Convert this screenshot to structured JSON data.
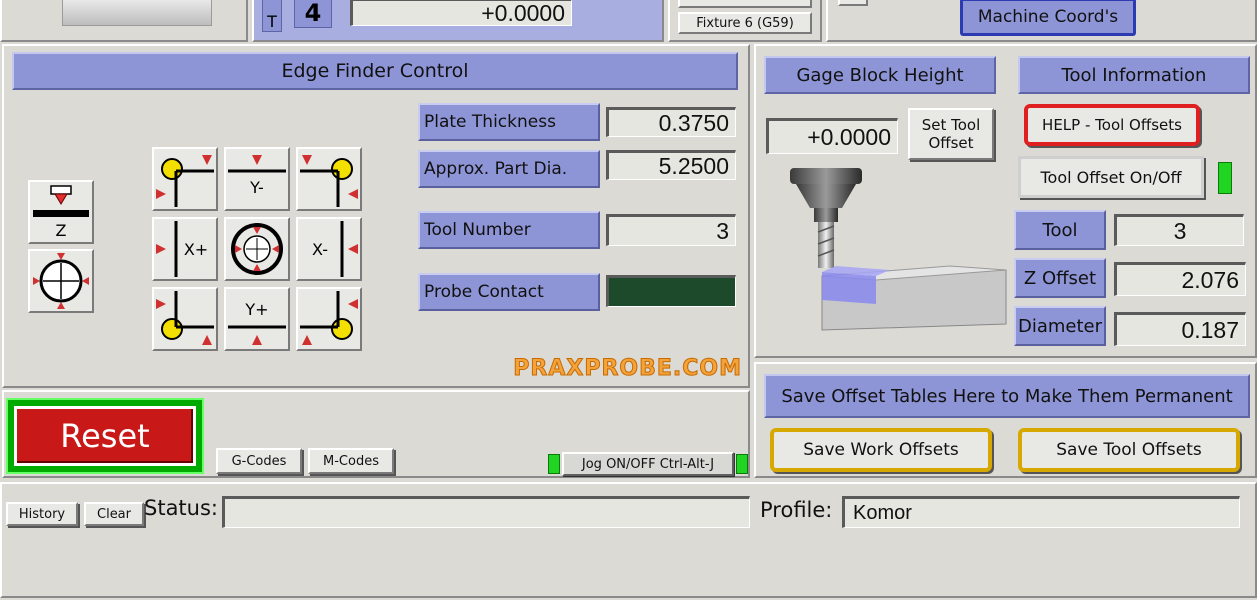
{
  "top": {
    "tool_letter": "T",
    "tool_number": "4",
    "tool_dro": "+0.0000",
    "fixture_label": "Fixture 6 (G59)",
    "machine_coords_label": "Machine Coord's"
  },
  "edge_finder": {
    "title": "Edge Finder Control",
    "plate_thickness_label": "Plate Thickness",
    "plate_thickness_value": "0.3750",
    "part_dia_label": "Approx. Part Dia.",
    "part_dia_value": "5.2500",
    "tool_number_label": "Tool Number",
    "tool_number_value": "3",
    "probe_contact_label": "Probe Contact",
    "z_label": "Z",
    "grid_labels": {
      "y_minus": "Y-",
      "x_plus": "X+",
      "x_minus": "X-",
      "y_plus": "Y+"
    },
    "logo_text": "PRAXPROBE.COM"
  },
  "gage_block": {
    "title": "Gage Block Height",
    "value": "+0.0000",
    "set_tool_offset_label": "Set Tool Offset"
  },
  "tool_info": {
    "title": "Tool Information",
    "help_label": "HELP - Tool Offsets",
    "tool_offset_toggle_label": "Tool Offset On/Off",
    "tool_label": "Tool",
    "tool_value": "3",
    "z_offset_label": "Z Offset",
    "z_offset_value": "2.076",
    "diameter_label": "Diameter",
    "diameter_value": "0.187"
  },
  "controls": {
    "reset_label": "Reset",
    "gcodes_label": "G-Codes",
    "mcodes_label": "M-Codes",
    "jog_label": "Jog ON/OFF Ctrl-Alt-J"
  },
  "save": {
    "banner": "Save Offset Tables Here to Make Them Permanent",
    "work_label": "Save Work Offsets",
    "tool_label": "Save Tool Offsets"
  },
  "status_bar": {
    "history_label": "History",
    "clear_label": "Clear",
    "status_label": "Status:",
    "status_value": "",
    "profile_label": "Profile:",
    "profile_value": "Komor"
  },
  "colors": {
    "panel": "#dcdad5",
    "label_blue": "#8e95d6",
    "led_green": "#22d422",
    "reset_red": "#d01818",
    "logo_orange": "#f4a23a"
  }
}
